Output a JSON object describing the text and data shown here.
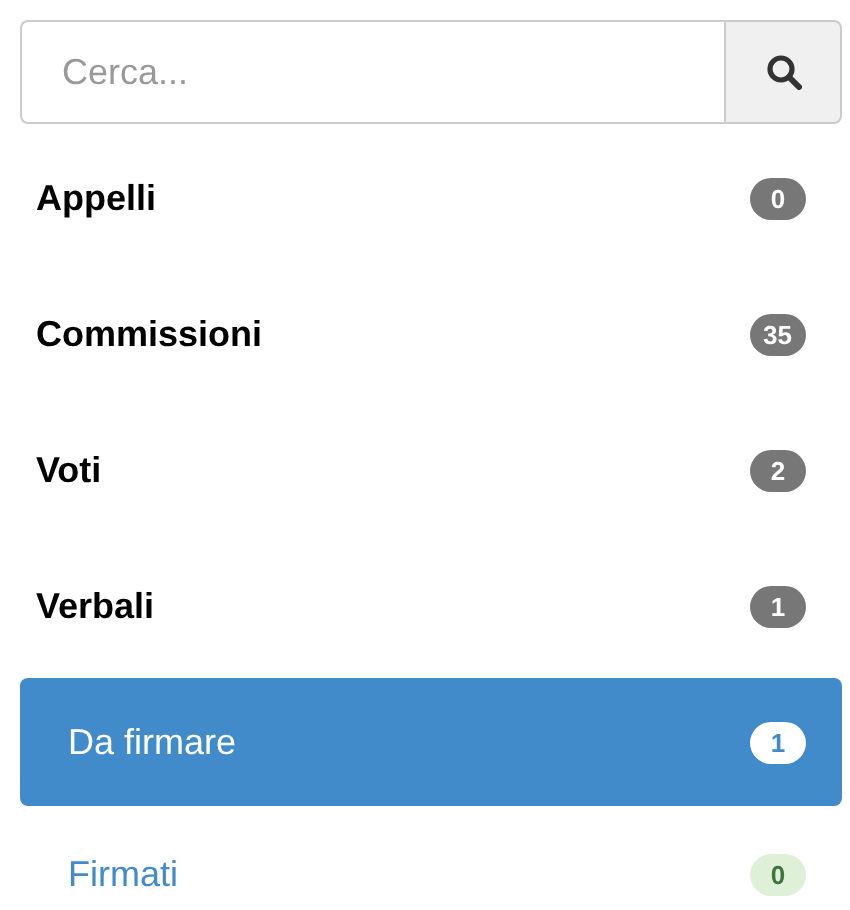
{
  "search": {
    "placeholder": "Cerca..."
  },
  "items": [
    {
      "label": "Appelli",
      "badge": "0",
      "color": "#777777"
    },
    {
      "label": "Commissioni",
      "badge": "35",
      "color": "#777777"
    },
    {
      "label": "Voti",
      "badge": "2",
      "color": "#777777"
    },
    {
      "label": "Verbali",
      "badge": "1",
      "color": "#777777",
      "children": [
        {
          "label": "Da firmare",
          "badge": "1",
          "color": "#ffffff",
          "selected": true
        },
        {
          "label": "Firmati",
          "badge": "0",
          "color": "#dff0d8",
          "selected": false
        }
      ]
    }
  ]
}
